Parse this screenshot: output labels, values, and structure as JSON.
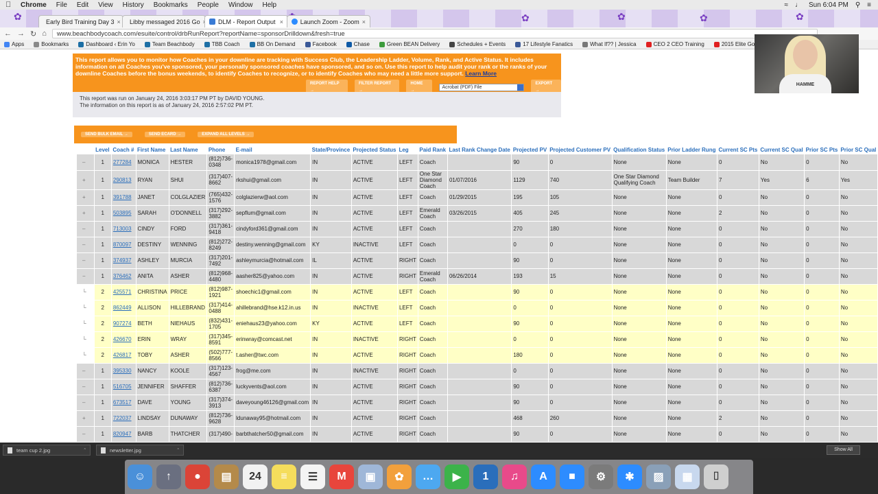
{
  "menubar": {
    "app": "Chrome",
    "items": [
      "File",
      "Edit",
      "View",
      "History",
      "Bookmarks",
      "People",
      "Window",
      "Help"
    ],
    "clock": "Sun 6:04 PM"
  },
  "tabs": [
    {
      "label": "Early Bird Training Day 3",
      "color": "#9a9a9a"
    },
    {
      "label": "Libby messaged 2016 Go",
      "color": "#3b5998"
    },
    {
      "label": "DLM - Report Output",
      "color": "#3a7bd5"
    },
    {
      "label": "Launch Zoom - Zoom",
      "color": "#2d8cff"
    }
  ],
  "address": {
    "url": "www.beachbodycoach.com/esuite/control/drbRunReport?reportName=sponsorDrilldown&fresh=true"
  },
  "bookmarks": [
    {
      "label": "Apps",
      "color": "#4285f4"
    },
    {
      "label": "Bookmarks",
      "color": "#888888"
    },
    {
      "label": "Dashboard ‹ Erin Yo",
      "color": "#1d6fa5"
    },
    {
      "label": "Team Beachbody",
      "color": "#1d6fa5"
    },
    {
      "label": "TBB Coach",
      "color": "#1d6fa5"
    },
    {
      "label": "BB On Demand",
      "color": "#1d6fa5"
    },
    {
      "label": "Facebook",
      "color": "#3b5998"
    },
    {
      "label": "Chase",
      "color": "#0f5aa6"
    },
    {
      "label": "Green BEAN Delivery",
      "color": "#3c9b3c"
    },
    {
      "label": "Schedules + Events",
      "color": "#444444"
    },
    {
      "label": "17 Lifestyle Fanatics",
      "color": "#3b5998"
    },
    {
      "label": "What If?? | Jessica",
      "color": "#777777"
    },
    {
      "label": "CEO 2 CEO Training",
      "color": "#e02020"
    },
    {
      "label": "2015 Elite Goal Cal",
      "color": "#e02020"
    }
  ],
  "webcam": {
    "shirt_text": "HAMME"
  },
  "report": {
    "description": "This report allows you to monitor how Coaches in your downline are tracking with Success Club, the Leadership Ladder, Volume, Rank, and Active Status. It includes information on all Coaches you've sponsored, your personally sponsored coaches have sponsored, and so on. Use this report to help audit your rank or the ranks of your downline Coaches before the bonus weekends, to identify Coaches to recognize, or to identify Coaches who may need a little more support.",
    "learn_more": "Learn More",
    "buttons": [
      "REPORT HELP →",
      "FILTER REPORT →",
      "HOME →",
      "EXPORT →"
    ],
    "export_format": "Acrobat (PDF) File",
    "run_line": "This report was run on January 24, 2016 3:03:17 PM PT by DAVID YOUNG.",
    "asof_line": "The information on this report is as of January 24, 2016 2:57:02 PM PT.",
    "actions": [
      "SEND BULK EMAIL →",
      "SEND ECARD →",
      "EXPAND ALL LEVELS →"
    ]
  },
  "table": {
    "columns": [
      "",
      "Level",
      "Coach #",
      "First Name",
      "Last Name",
      "Phone",
      "E-mail",
      "State/Province",
      "Projected Status",
      "Leg",
      "Paid Rank",
      "Last Rank Change Date",
      "Projected PV",
      "Projected Customer PV",
      "Qualification Status",
      "Prior Ladder Rung",
      "Current SC Pts",
      "Current SC Qual",
      "Prior SC Pts",
      "Prior SC Qual"
    ],
    "rows": [
      {
        "exp": "–",
        "level": "1",
        "coach": "277284",
        "first": "MONICA",
        "last": "HESTER",
        "phone": "(812)736-0348",
        "email": "monica1978@gmail.com",
        "state": "IN",
        "status": "ACTIVE",
        "leg": "LEFT",
        "rank": "Coach",
        "rank_date": "",
        "pv": "90",
        "cpv": "0",
        "qual": "None",
        "ladder": "None",
        "csc": "0",
        "cscq": "No",
        "psc": "0",
        "pscq": "No",
        "tier": "l1"
      },
      {
        "exp": "+",
        "level": "1",
        "coach": "290813",
        "first": "RYAN",
        "last": "SHUI",
        "phone": "(317)407-8662",
        "email": "rkshui@gmail.com",
        "state": "IN",
        "status": "ACTIVE",
        "leg": "LEFT",
        "rank": "One Star Diamond Coach",
        "rank_date": "01/07/2016",
        "pv": "1129",
        "cpv": "740",
        "qual": "One Star Diamond Qualifying Coach",
        "ladder": "Team Builder",
        "csc": "7",
        "cscq": "Yes",
        "psc": "6",
        "pscq": "Yes",
        "tier": "l1"
      },
      {
        "exp": "+",
        "level": "1",
        "coach": "391788",
        "first": "JANET",
        "last": "COLGLAZIER",
        "phone": "(765)432-1576",
        "email": "colglazierw@aol.com",
        "state": "IN",
        "status": "ACTIVE",
        "leg": "LEFT",
        "rank": "Coach",
        "rank_date": "01/29/2015",
        "pv": "195",
        "cpv": "105",
        "qual": "None",
        "ladder": "None",
        "csc": "0",
        "cscq": "No",
        "psc": "0",
        "pscq": "No",
        "tier": "l1"
      },
      {
        "exp": "+",
        "level": "1",
        "coach": "503895",
        "first": "SARAH",
        "last": "O'DONNELL",
        "phone": "(317)292-3882",
        "email": "sepflum@gmail.com",
        "state": "IN",
        "status": "ACTIVE",
        "leg": "LEFT",
        "rank": "Emerald Coach",
        "rank_date": "03/26/2015",
        "pv": "405",
        "cpv": "245",
        "qual": "None",
        "ladder": "None",
        "csc": "2",
        "cscq": "No",
        "psc": "0",
        "pscq": "No",
        "tier": "l1"
      },
      {
        "exp": "–",
        "level": "1",
        "coach": "713003",
        "first": "CINDY",
        "last": "FORD",
        "phone": "(317)361-9418",
        "email": "cindyford361@gmail.com",
        "state": "IN",
        "status": "ACTIVE",
        "leg": "LEFT",
        "rank": "Coach",
        "rank_date": "",
        "pv": "270",
        "cpv": "180",
        "qual": "None",
        "ladder": "None",
        "csc": "0",
        "cscq": "No",
        "psc": "0",
        "pscq": "No",
        "tier": "l1"
      },
      {
        "exp": "–",
        "level": "1",
        "coach": "870097",
        "first": "DESTINY",
        "last": "WENNING",
        "phone": "(812)272-8249",
        "email": "destiny.wenning@gmail.com",
        "state": "KY",
        "status": "INACTIVE",
        "leg": "LEFT",
        "rank": "Coach",
        "rank_date": "",
        "pv": "0",
        "cpv": "0",
        "qual": "None",
        "ladder": "None",
        "csc": "0",
        "cscq": "No",
        "psc": "0",
        "pscq": "No",
        "tier": "l1"
      },
      {
        "exp": "–",
        "level": "1",
        "coach": "374937",
        "first": "ASHLEY",
        "last": "MURCIA",
        "phone": "(317)201-7492",
        "email": "ashleymurcia@hotmail.com",
        "state": "IL",
        "status": "ACTIVE",
        "leg": "RIGHT",
        "rank": "Coach",
        "rank_date": "",
        "pv": "90",
        "cpv": "0",
        "qual": "None",
        "ladder": "None",
        "csc": "0",
        "cscq": "No",
        "psc": "0",
        "pscq": "No",
        "tier": "l1"
      },
      {
        "exp": "−",
        "level": "1",
        "coach": "376462",
        "first": "ANITA",
        "last": "ASHER",
        "phone": "(812)968-4480",
        "email": "aasher825@yahoo.com",
        "state": "IN",
        "status": "ACTIVE",
        "leg": "RIGHT",
        "rank": "Emerald Coach",
        "rank_date": "06/26/2014",
        "pv": "193",
        "cpv": "15",
        "qual": "None",
        "ladder": "None",
        "csc": "0",
        "cscq": "No",
        "psc": "0",
        "pscq": "No",
        "tier": "l1"
      },
      {
        "exp": "└",
        "level": "2",
        "coach": "425571",
        "first": "CHRISTINA",
        "last": "PRICE",
        "phone": "(812)987-1921",
        "email": "shoechic1@gmail.com",
        "state": "IN",
        "status": "ACTIVE",
        "leg": "LEFT",
        "rank": "Coach",
        "rank_date": "",
        "pv": "90",
        "cpv": "0",
        "qual": "None",
        "ladder": "None",
        "csc": "0",
        "cscq": "No",
        "psc": "0",
        "pscq": "No",
        "tier": "l2"
      },
      {
        "exp": "└",
        "level": "2",
        "coach": "862449",
        "first": "ALLISON",
        "last": "HILLEBRAND",
        "phone": "(317)414-0488",
        "email": "ahillebrand@hse.k12.in.us",
        "state": "IN",
        "status": "INACTIVE",
        "leg": "LEFT",
        "rank": "Coach",
        "rank_date": "",
        "pv": "0",
        "cpv": "0",
        "qual": "None",
        "ladder": "None",
        "csc": "0",
        "cscq": "No",
        "psc": "0",
        "pscq": "No",
        "tier": "l2"
      },
      {
        "exp": "└",
        "level": "2",
        "coach": "907274",
        "first": "BETH",
        "last": "NIEHAUS",
        "phone": "(832)431-1705",
        "email": "eniehaus23@yahoo.com",
        "state": "KY",
        "status": "ACTIVE",
        "leg": "LEFT",
        "rank": "Coach",
        "rank_date": "",
        "pv": "90",
        "cpv": "0",
        "qual": "None",
        "ladder": "None",
        "csc": "0",
        "cscq": "No",
        "psc": "0",
        "pscq": "No",
        "tier": "l2"
      },
      {
        "exp": "└",
        "level": "2",
        "coach": "426670",
        "first": "ERIN",
        "last": "WRAY",
        "phone": "(317)345-8591",
        "email": "erinwray@comcast.net",
        "state": "IN",
        "status": "INACTIVE",
        "leg": "RIGHT",
        "rank": "Coach",
        "rank_date": "",
        "pv": "0",
        "cpv": "0",
        "qual": "None",
        "ladder": "None",
        "csc": "0",
        "cscq": "No",
        "psc": "0",
        "pscq": "No",
        "tier": "l2"
      },
      {
        "exp": "└",
        "level": "2",
        "coach": "426817",
        "first": "TOBY",
        "last": "ASHER",
        "phone": "(502)777-8566",
        "email": "t.asher@twc.com",
        "state": "IN",
        "status": "ACTIVE",
        "leg": "RIGHT",
        "rank": "Coach",
        "rank_date": "",
        "pv": "180",
        "cpv": "0",
        "qual": "None",
        "ladder": "None",
        "csc": "0",
        "cscq": "No",
        "psc": "0",
        "pscq": "No",
        "tier": "l2"
      },
      {
        "exp": "–",
        "level": "1",
        "coach": "395330",
        "first": "NANCY",
        "last": "KOOLE",
        "phone": "(317)123-4567",
        "email": "frog@me.com",
        "state": "IN",
        "status": "INACTIVE",
        "leg": "RIGHT",
        "rank": "Coach",
        "rank_date": "",
        "pv": "0",
        "cpv": "0",
        "qual": "None",
        "ladder": "None",
        "csc": "0",
        "cscq": "No",
        "psc": "0",
        "pscq": "No",
        "tier": "l1"
      },
      {
        "exp": "–",
        "level": "1",
        "coach": "516705",
        "first": "JENNIFER",
        "last": "SHAFFER",
        "phone": "(812)736-6387",
        "email": "luckyvents@aol.com",
        "state": "IN",
        "status": "ACTIVE",
        "leg": "RIGHT",
        "rank": "Coach",
        "rank_date": "",
        "pv": "90",
        "cpv": "0",
        "qual": "None",
        "ladder": "None",
        "csc": "0",
        "cscq": "No",
        "psc": "0",
        "pscq": "No",
        "tier": "l1"
      },
      {
        "exp": "–",
        "level": "1",
        "coach": "673517",
        "first": "DAVE",
        "last": "YOUNG",
        "phone": "(317)374-3913",
        "email": "daveyoung46126@gmail.com",
        "state": "IN",
        "status": "ACTIVE",
        "leg": "RIGHT",
        "rank": "Coach",
        "rank_date": "",
        "pv": "90",
        "cpv": "0",
        "qual": "None",
        "ladder": "None",
        "csc": "0",
        "cscq": "No",
        "psc": "0",
        "pscq": "No",
        "tier": "l1"
      },
      {
        "exp": "+",
        "level": "1",
        "coach": "722037",
        "first": "LINDSAY",
        "last": "DUNAWAY",
        "phone": "(812)736-9628",
        "email": "ldunaway95@hotmail.com",
        "state": "IN",
        "status": "ACTIVE",
        "leg": "RIGHT",
        "rank": "Coach",
        "rank_date": "",
        "pv": "468",
        "cpv": "260",
        "qual": "None",
        "ladder": "None",
        "csc": "2",
        "cscq": "No",
        "psc": "0",
        "pscq": "No",
        "tier": "l1"
      },
      {
        "exp": "–",
        "level": "1",
        "coach": "820947",
        "first": "BARB",
        "last": "THATCHER",
        "phone": "(317)490-",
        "email": "barbthatcher50@gmail.com",
        "state": "IN",
        "status": "ACTIVE",
        "leg": "RIGHT",
        "rank": "Coach",
        "rank_date": "",
        "pv": "90",
        "cpv": "0",
        "qual": "None",
        "ladder": "None",
        "csc": "0",
        "cscq": "No",
        "psc": "0",
        "pscq": "No",
        "tier": "l1"
      }
    ]
  },
  "downloads": [
    {
      "label": "team cup 2.jpg"
    },
    {
      "label": "newsletter.jpg"
    }
  ],
  "show_all": "Show All",
  "dock": [
    {
      "name": "finder",
      "color": "#4a90d9",
      "glyph": "☺"
    },
    {
      "name": "launchpad",
      "color": "#6a6f80",
      "glyph": "↑"
    },
    {
      "name": "chrome",
      "color": "#db4437",
      "glyph": "●"
    },
    {
      "name": "notebook",
      "color": "#b48a4a",
      "glyph": "▤"
    },
    {
      "name": "calendar",
      "color": "#f2f2f2",
      "glyph": "24"
    },
    {
      "name": "notes",
      "color": "#f5dd5c",
      "glyph": "≡"
    },
    {
      "name": "reminders",
      "color": "#f4f4f4",
      "glyph": "☰"
    },
    {
      "name": "gmail",
      "color": "#e8453c",
      "glyph": "M"
    },
    {
      "name": "preview",
      "color": "#9fb7d8",
      "glyph": "▣"
    },
    {
      "name": "photos",
      "color": "#f2a03c",
      "glyph": "✿"
    },
    {
      "name": "messages",
      "color": "#4da8f0",
      "glyph": "…"
    },
    {
      "name": "facetime",
      "color": "#3cb34a",
      "glyph": "▶"
    },
    {
      "name": "1password",
      "color": "#2a6ebb",
      "glyph": "1"
    },
    {
      "name": "itunes",
      "color": "#e84a8a",
      "glyph": "♫"
    },
    {
      "name": "app-store",
      "color": "#2d8cff",
      "glyph": "A"
    },
    {
      "name": "zoom",
      "color": "#2d8cff",
      "glyph": "■"
    },
    {
      "name": "system-preferences",
      "color": "#7b7b7b",
      "glyph": "⚙"
    },
    {
      "name": "bluetooth",
      "color": "#2d8cff",
      "glyph": "✱"
    },
    {
      "name": "image-capture",
      "color": "#8aa0b8",
      "glyph": "▨"
    },
    {
      "name": "documents",
      "color": "#c8d8ee",
      "glyph": "▦"
    },
    {
      "name": "trash",
      "color": "#cfcfcf",
      "glyph": "⌷"
    }
  ]
}
